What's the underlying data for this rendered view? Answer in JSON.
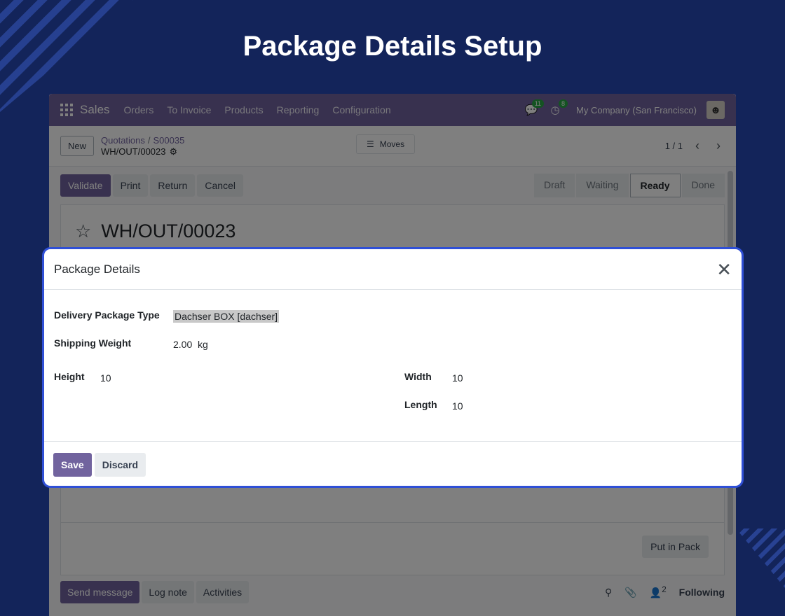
{
  "page": {
    "title": "Package Details Setup"
  },
  "navbar": {
    "brand": "Sales",
    "menus": [
      "Orders",
      "To Invoice",
      "Products",
      "Reporting",
      "Configuration"
    ],
    "messages_count": "11",
    "activities_count": "8",
    "company": "My Company (San Francisco)"
  },
  "control": {
    "new_label": "New",
    "breadcrumb": [
      "Quotations",
      "S00035"
    ],
    "current": "WH/OUT/00023",
    "moves_label": "Moves",
    "pager": "1 / 1"
  },
  "actions": [
    "Validate",
    "Print",
    "Return",
    "Cancel"
  ],
  "status_steps": [
    "Draft",
    "Waiting",
    "Ready",
    "Done"
  ],
  "active_status": "Ready",
  "record": {
    "name": "WH/OUT/00023",
    "put_in_pack": "Put in Pack"
  },
  "chatter": {
    "buttons": [
      "Send message",
      "Log note",
      "Activities"
    ],
    "followers_count": "2",
    "following": "Following"
  },
  "modal": {
    "title": "Package Details",
    "delivery_package_type_label": "Delivery Package Type",
    "delivery_package_type_value": "Dachser BOX [dachser]",
    "shipping_weight_label": "Shipping Weight",
    "shipping_weight_value": "2.00",
    "shipping_weight_unit": "kg",
    "height_label": "Height",
    "height_value": "10",
    "width_label": "Width",
    "width_value": "10",
    "length_label": "Length",
    "length_value": "10",
    "save_label": "Save",
    "discard_label": "Discard"
  },
  "colors": {
    "background": "#13245a",
    "primary": "#71639e",
    "modal_border": "#2f4fd6"
  }
}
